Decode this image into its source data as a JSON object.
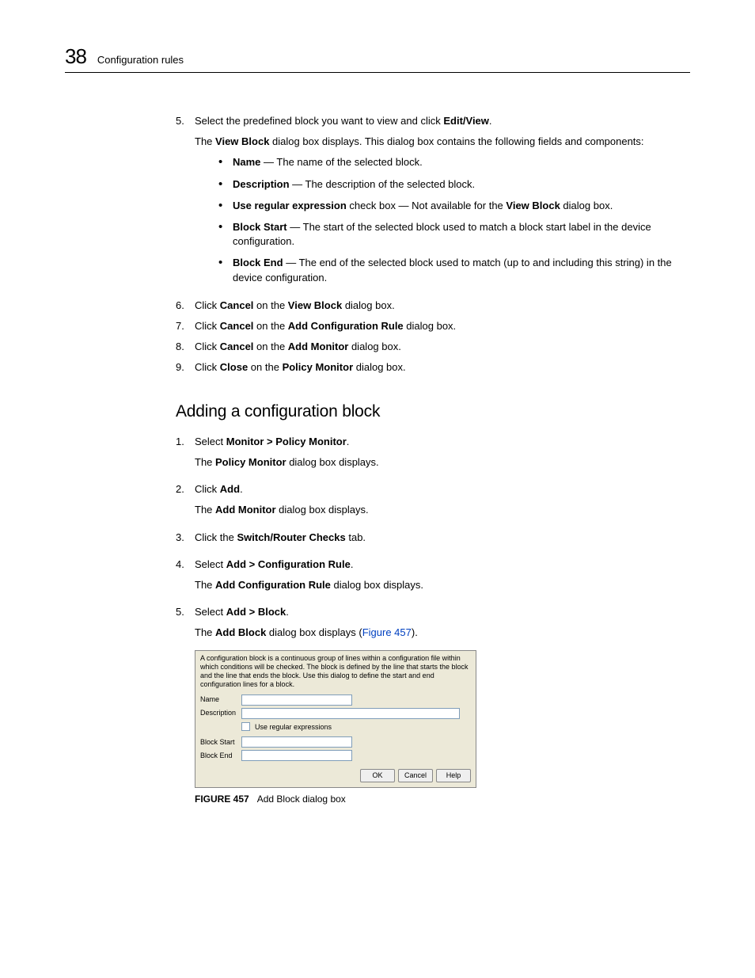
{
  "header": {
    "number": "38",
    "title": "Configuration rules"
  },
  "list1": {
    "i5": {
      "num": "5.",
      "text_a": "Select the predefined block you want to view and click ",
      "text_b": "Edit/View",
      "text_c": ".",
      "para_a": "The ",
      "para_b": "View Block",
      "para_c": " dialog box displays. This dialog box contains the following fields and components:",
      "bullets": {
        "b1": {
          "a": "Name",
          "b": " — The name of the selected block."
        },
        "b2": {
          "a": "Description",
          "b": " — The description of the selected block."
        },
        "b3": {
          "a": "Use regular expression",
          "b": " check box — Not available for the ",
          "c": "View Block",
          "d": " dialog box."
        },
        "b4": {
          "a": "Block Start",
          "b": " — The start of the selected block used to match a block start label in the device configuration."
        },
        "b5": {
          "a": "Block End",
          "b": " — The end of the selected block used to match (up to and including this string) in the device configuration."
        }
      }
    },
    "i6": {
      "num": "6.",
      "a": "Click ",
      "b": "Cancel",
      "c": " on the ",
      "d": "View Block",
      "e": " dialog box."
    },
    "i7": {
      "num": "7.",
      "a": "Click ",
      "b": "Cancel",
      "c": " on the ",
      "d": "Add Configuration Rule",
      "e": " dialog box."
    },
    "i8": {
      "num": "8.",
      "a": "Click ",
      "b": "Cancel",
      "c": " on the ",
      "d": "Add Monitor",
      "e": " dialog box."
    },
    "i9": {
      "num": "9.",
      "a": "Click ",
      "b": "Close",
      "c": " on the ",
      "d": "Policy Monitor",
      "e": " dialog box."
    }
  },
  "section2": {
    "title": "Adding a configuration block"
  },
  "list2": {
    "i1": {
      "num": "1.",
      "a": "Select ",
      "b": "Monitor > Policy Monitor",
      "c": ".",
      "p_a": "The ",
      "p_b": "Policy Monitor",
      "p_c": " dialog box displays."
    },
    "i2": {
      "num": "2.",
      "a": "Click ",
      "b": "Add",
      "c": ".",
      "p_a": "The ",
      "p_b": "Add Monitor",
      "p_c": " dialog box displays."
    },
    "i3": {
      "num": "3.",
      "a": "Click the ",
      "b": "Switch/Router Checks",
      "c": " tab."
    },
    "i4": {
      "num": "4.",
      "a": "Select ",
      "b": "Add > Configuration Rule",
      "c": ".",
      "p_a": "The ",
      "p_b": "Add Configuration Rule",
      "p_c": " dialog box displays."
    },
    "i5": {
      "num": "5.",
      "a": "Select ",
      "b": "Add > Block",
      "c": ".",
      "p_a": "The ",
      "p_b": "Add Block",
      "p_c": " dialog box displays (",
      "p_link": "Figure 457",
      "p_d": ")."
    }
  },
  "dialog": {
    "intro": "A configuration block is a continuous group of lines within a configuration file within which conditions will be checked. The block is defined by the line that starts the block and the line that ends the block. Use this dialog to define the start and end configuration lines for a block.",
    "name_label": "Name",
    "desc_label": "Description",
    "chk_label": "Use regular expressions",
    "start_label": "Block Start",
    "end_label": "Block End",
    "ok": "OK",
    "cancel": "Cancel",
    "help": "Help"
  },
  "figure": {
    "label": "FIGURE 457",
    "caption": "Add Block dialog box"
  }
}
